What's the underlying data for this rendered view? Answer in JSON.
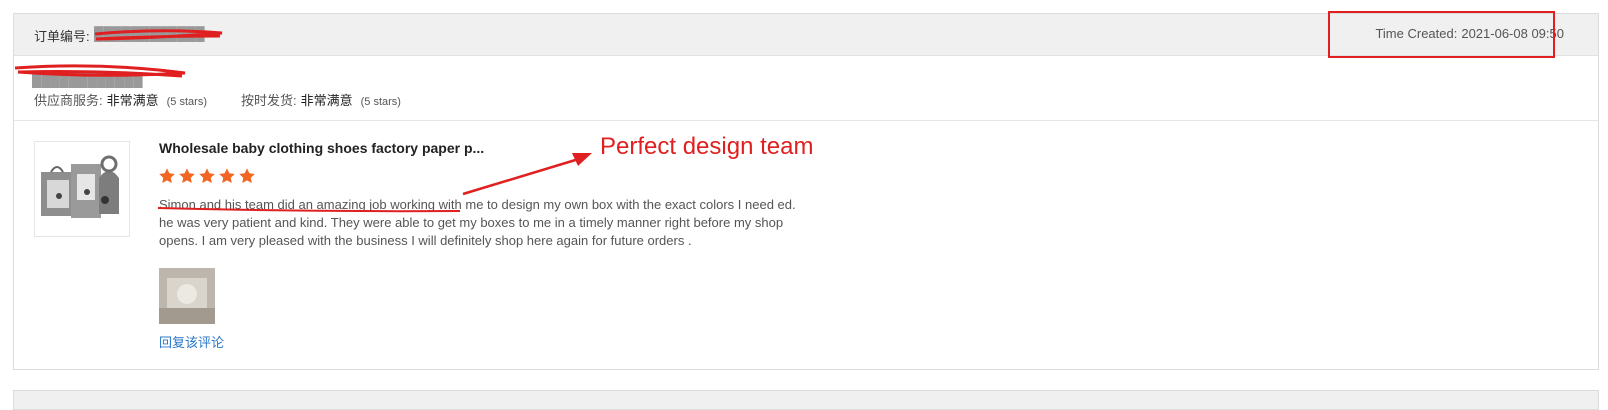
{
  "header": {
    "order_label": "订单编号:",
    "order_number": "████████████",
    "time_created_label": "Time Created:",
    "time_created_value": "2021-06-08 09:50"
  },
  "buyer": {
    "name": "████████████"
  },
  "ratings": [
    {
      "label": "供应商服务:",
      "value": "非常满意",
      "stars": "(5 stars)"
    },
    {
      "label": "按时发货:",
      "value": "非常满意",
      "stars": "(5 stars)"
    }
  ],
  "review": {
    "product_title": "Wholesale baby clothing shoes factory paper p...",
    "star_count": 5,
    "text": "Simon and his team did an amazing job working with me to design my own box with the exact colors I need ed. he was very patient and kind. They were able to get my boxes to me in a timely manner right before my shop opens. I am very pleased with the business I will definitely shop here again for future orders .",
    "reply_label": "回复该评论"
  },
  "annotation": {
    "text": "Perfect design team",
    "color": "#e02020"
  },
  "colors": {
    "star": "#f26522",
    "link": "#2a78c8",
    "header_bg": "#f0f0f0"
  }
}
